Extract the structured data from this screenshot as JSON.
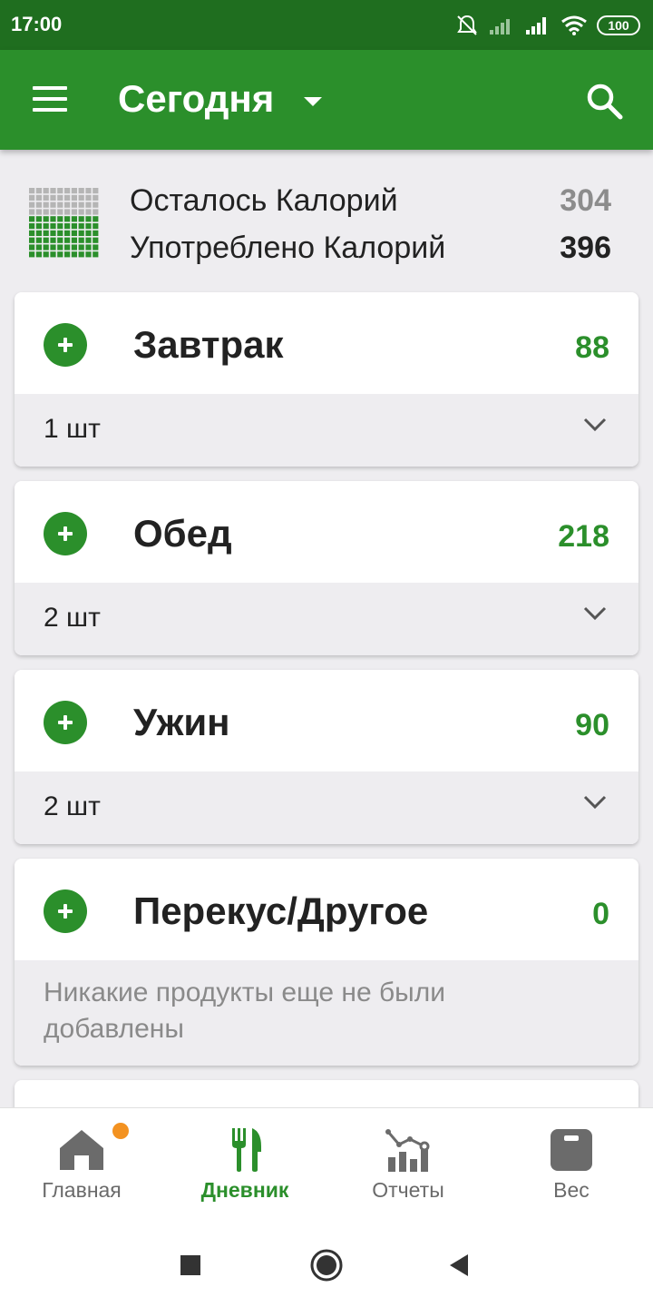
{
  "status_bar": {
    "time": "17:00",
    "battery": "100"
  },
  "app_bar": {
    "title": "Сегодня"
  },
  "summary": {
    "remaining_label": "Осталось Калорий",
    "remaining_value": "304",
    "consumed_label": "Употреблено Калорий",
    "consumed_value": "396",
    "consumed_fraction": 0.566
  },
  "meals": [
    {
      "name": "Завтрак",
      "calories": "88",
      "count": "1 шт"
    },
    {
      "name": "Обед",
      "calories": "218",
      "count": "2 шт"
    },
    {
      "name": "Ужин",
      "calories": "90",
      "count": "2 шт"
    },
    {
      "name": "Перекус/Другое",
      "calories": "0",
      "empty_text": "Никакие продукты еще не были добавлены"
    }
  ],
  "bottom_nav": [
    {
      "label": "Главная",
      "icon": "home-icon",
      "has_badge": true
    },
    {
      "label": "Дневник",
      "icon": "diary-icon",
      "active": true
    },
    {
      "label": "Отчеты",
      "icon": "reports-icon"
    },
    {
      "label": "Вес",
      "icon": "weight-icon"
    }
  ],
  "colors": {
    "primary": "#2b8f2b",
    "status_bar": "#1f6e1f",
    "badge": "#f39221",
    "text": "#222222",
    "muted": "#8a8a8a"
  }
}
